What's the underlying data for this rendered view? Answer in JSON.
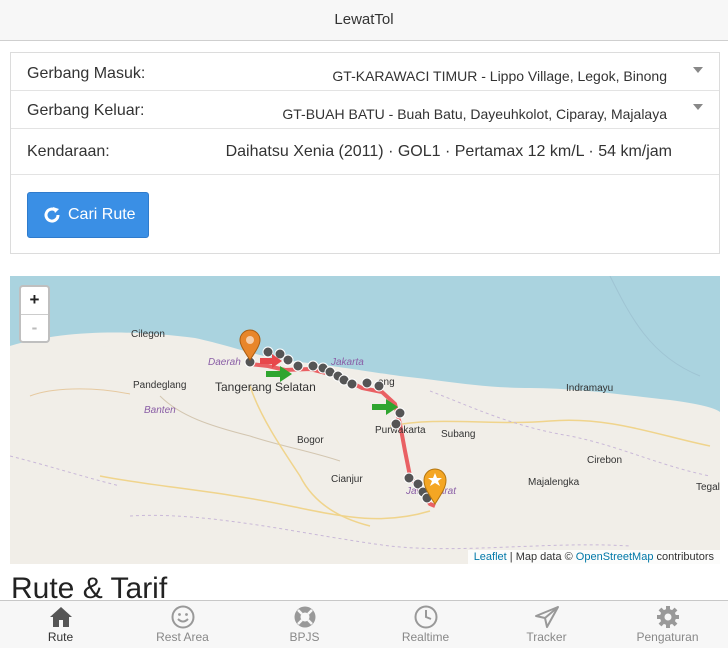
{
  "app": {
    "title": "LewatTol"
  },
  "form": {
    "entry_label": "Gerbang Masuk:",
    "entry_value": "GT-KARAWACI TIMUR - Lippo Village, Legok, Binong",
    "exit_label": "Gerbang Keluar:",
    "exit_value": "GT-BUAH BATU - Buah Batu, Dayeuhkolot, Ciparay, Majalaya",
    "vehicle_label": "Kendaraan:",
    "vehicle_value": "Daihatsu Xenia (2011) · GOL1 · Pertamax 12 km/L · 54 km/jam",
    "search_button": "Cari Rute"
  },
  "map": {
    "zoom_in": "+",
    "zoom_out": "-",
    "attribution": {
      "leaflet": "Leaflet",
      "map_data": "| Map data ©",
      "osm": "OpenStreetMap",
      "contributors": "contributors"
    },
    "places": [
      "Cilegon",
      "Pandeglang",
      "Banten",
      "Tangerang Selatan",
      "Bogor",
      "Cianjur",
      "Purwakarta",
      "Subang",
      "Indramayu",
      "Cirebon",
      "Majalengka",
      "Tegal",
      "Daerah",
      "Jakarta",
      "ang",
      "Jawa Barat"
    ],
    "route_color": "#e8474b",
    "marker_start_color": "#e8862a",
    "marker_end_color": "#f4a623"
  },
  "section": {
    "title": "Rute & Tarif"
  },
  "tabs": [
    {
      "label": "Rute",
      "icon": "home-icon",
      "active": true
    },
    {
      "label": "Rest Area",
      "icon": "smiley-icon",
      "active": false
    },
    {
      "label": "BPJS",
      "icon": "lifebuoy-icon",
      "active": false
    },
    {
      "label": "Realtime",
      "icon": "clock-icon",
      "active": false
    },
    {
      "label": "Tracker",
      "icon": "send-icon",
      "active": false
    },
    {
      "label": "Pengaturan",
      "icon": "gear-icon",
      "active": false
    }
  ]
}
